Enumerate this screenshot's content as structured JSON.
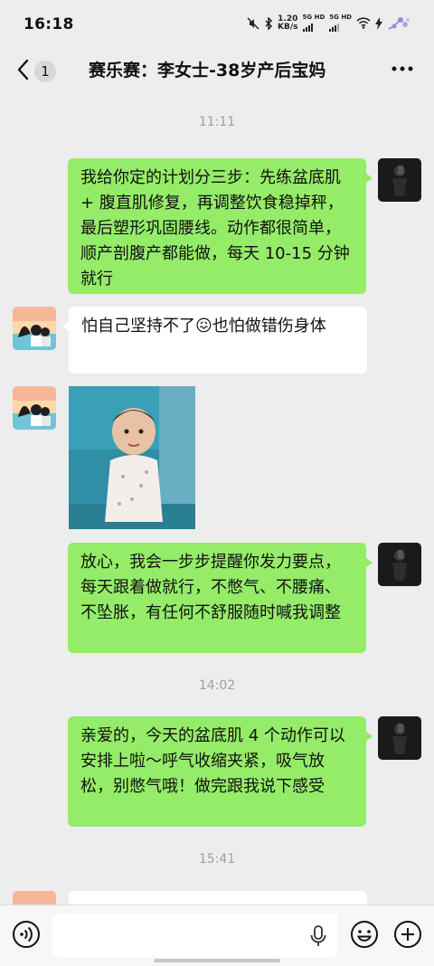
{
  "status_bar": {
    "time": "16:18",
    "net_speed_value": "1.20",
    "net_speed_unit": "KB/s",
    "sim1": "5G HD",
    "sim2": "5G HD"
  },
  "header": {
    "unread_count": "1",
    "title": "赛乐赛：李女士-38岁产后宝妈"
  },
  "messages": {
    "ts1": "11:11",
    "m1": "我给你定的计划分三步：先练盆底肌 + 腹直肌修复，再调整饮食稳掉秤，最后塑形巩固腰线。动作都很简单，顺产剖腹产都能做，每天 10-15 分钟就行",
    "m2": "怕自己坚持不了😖也怕做错伤身体",
    "m4": "放心，我会一步步提醒你发力要点，每天跟着做就行，不憋气、不腰痛、不坠胀，有任何不舒服随时喊我调整",
    "ts2": "14:02",
    "m5": "亲爱的，今天的盆底肌 4 个动作可以安排上啦～呼气收缩夹紧，吸气放松，别憋气哦！做完跟我说下感受",
    "ts3": "15:41"
  },
  "colors": {
    "my_bubble": "#95ec69",
    "other_bubble": "#ffffff",
    "background": "#ededed"
  }
}
